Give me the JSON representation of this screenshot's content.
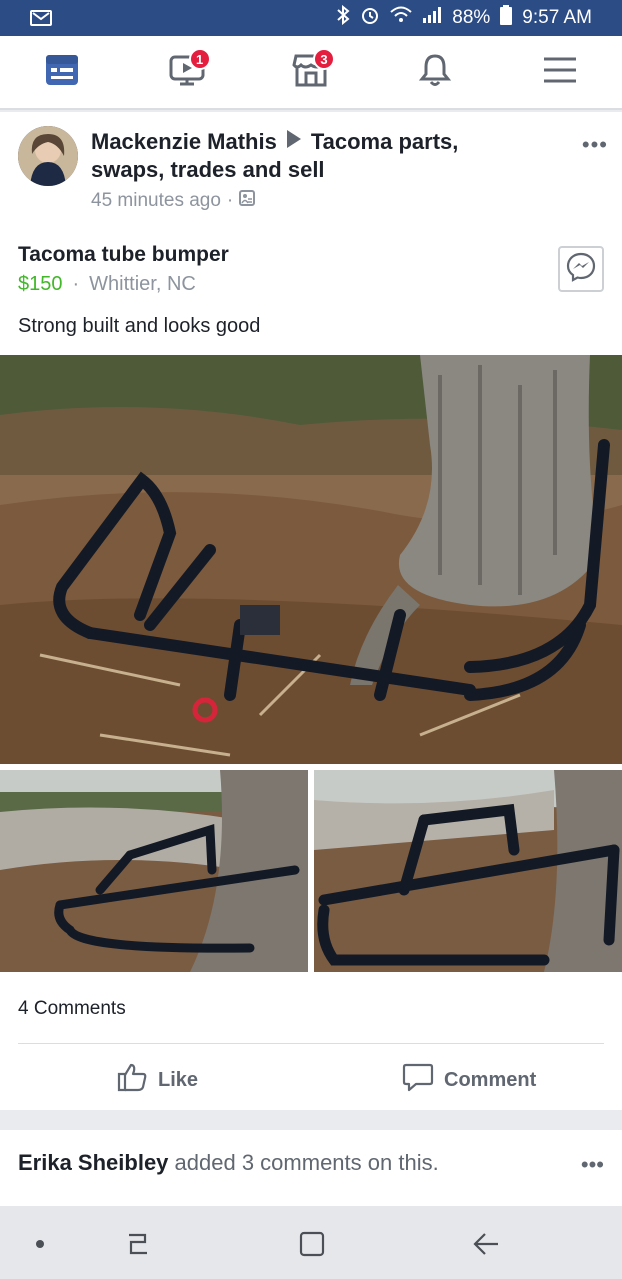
{
  "status_bar": {
    "battery": "88%",
    "time": "9:57 AM",
    "icons": [
      "email-icon",
      "bluetooth-icon",
      "alarm-icon",
      "wifi-icon",
      "signal-icon",
      "battery-icon"
    ]
  },
  "top_nav": {
    "items": [
      {
        "icon": "news-feed-icon",
        "active": true
      },
      {
        "icon": "watch-icon",
        "badge": "1"
      },
      {
        "icon": "marketplace-icon",
        "badge": "3"
      },
      {
        "icon": "notifications-icon"
      },
      {
        "icon": "menu-icon"
      }
    ],
    "accent": "#4267b2",
    "badge_color": "#e41e3f"
  },
  "post": {
    "author": "Mackenzie Mathis",
    "group": "Tacoma parts,",
    "group_line2": "swaps, trades and sell",
    "time": "45 minutes ago",
    "separator": "·",
    "more": "•••",
    "item_title": "Tacoma tube bumper",
    "price": "$150",
    "dot": "·",
    "location": "Whittier, NC",
    "description": "Strong built and looks good",
    "comments_count": "4 Comments",
    "like_label": "Like",
    "comment_label": "Comment",
    "price_color": "#42b72a"
  },
  "activity": {
    "actor": "Erika Sheibley",
    "text": "added 3 comments on this.",
    "more": "•••"
  },
  "system_nav": {
    "icons": [
      "dot-icon",
      "recent-apps-icon",
      "home-icon",
      "back-icon"
    ]
  }
}
